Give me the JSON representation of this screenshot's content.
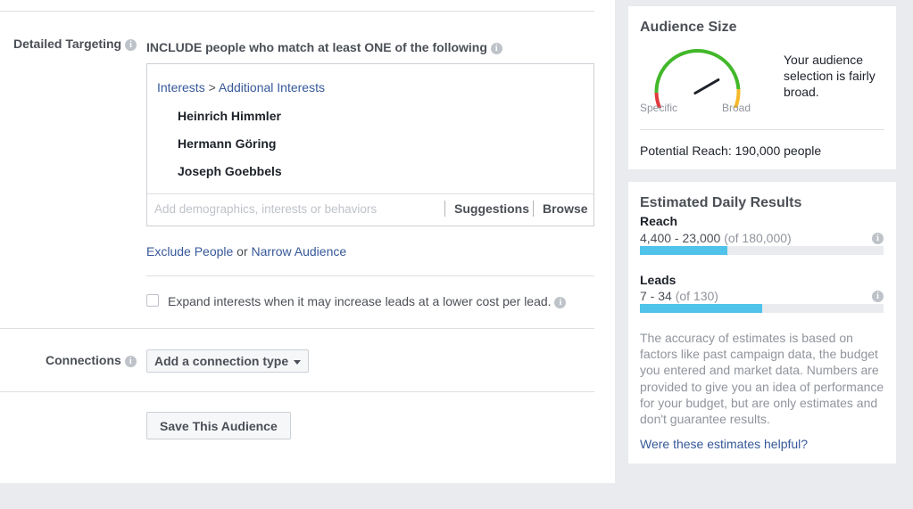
{
  "targeting": {
    "detailed_label": "Detailed Targeting",
    "include_text": "INCLUDE people who match at least ONE of the following",
    "breadcrumb_interests": "Interests",
    "breadcrumb_sep": " > ",
    "breadcrumb_additional": "Additional Interests",
    "items": [
      "Heinrich Himmler",
      "Hermann Göring",
      "Joseph Goebbels"
    ],
    "input_placeholder": "Add demographics, interests or behaviors",
    "suggestions": "Suggestions",
    "browse": "Browse",
    "exclude_people": "Exclude People",
    "or_text": " or ",
    "narrow_audience": "Narrow Audience",
    "expand_label": "Expand interests when it may increase leads at a lower cost per lead."
  },
  "connections": {
    "label": "Connections",
    "button": "Add a connection type"
  },
  "save_button": "Save This Audience",
  "audience_size": {
    "title": "Audience Size",
    "specific": "Specific",
    "broad": "Broad",
    "description": "Your audience selection is fairly broad.",
    "potential_reach": "Potential Reach: 190,000 people",
    "gauge_level": 0.75
  },
  "estimated": {
    "title": "Estimated Daily Results",
    "reach_label": "Reach",
    "reach_range": "4,400 - 23,000",
    "reach_of": "(of 180,000)",
    "reach_fill": 0.36,
    "leads_label": "Leads",
    "leads_range": "7 - 34",
    "leads_of": "(of 130)",
    "leads_fill": 0.5,
    "disclaimer": "The accuracy of estimates is based on factors like past campaign data, the budget you entered and market data. Numbers are provided to give you an idea of performance for your budget, but are only estimates and don't guarantee results.",
    "helpful": "Were these estimates helpful?"
  },
  "colors": {
    "link": "#365899",
    "bar": "#4fc3e9",
    "gauge_red": "#e0393e",
    "gauge_green": "#42b72a",
    "gauge_orange": "#f7b928"
  }
}
